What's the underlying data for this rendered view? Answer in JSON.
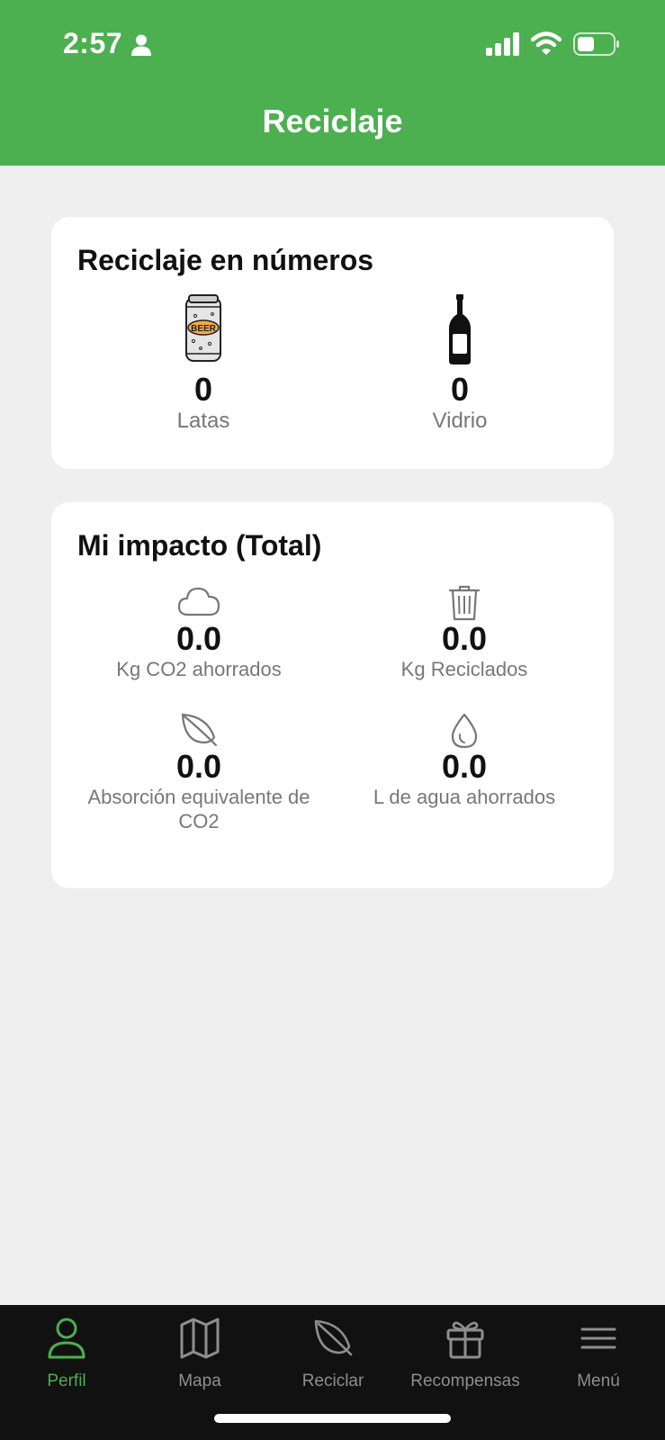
{
  "status_bar": {
    "time": "2:57"
  },
  "header": {
    "title": "Reciclaje"
  },
  "numbers_card": {
    "title": "Reciclaje en números",
    "items": [
      {
        "icon": "beer-can-icon",
        "can_text": "BEER",
        "value": "0",
        "label": "Latas"
      },
      {
        "icon": "wine-bottle-icon",
        "value": "0",
        "label": "Vidrio"
      }
    ]
  },
  "impact_card": {
    "title": "Mi impacto (Total)",
    "items": [
      {
        "icon": "cloud-icon",
        "value": "0.0",
        "label": "Kg CO2 ahorrados"
      },
      {
        "icon": "trash-icon",
        "value": "0.0",
        "label": "Kg Reciclados"
      },
      {
        "icon": "leaf-icon",
        "value": "0.0",
        "label": "Absorción equivalente de CO2"
      },
      {
        "icon": "water-drop-icon",
        "value": "0.0",
        "label": "L de agua ahorrados"
      }
    ]
  },
  "tabbar": {
    "items": [
      {
        "icon": "person-icon",
        "label": "Perfil",
        "active": true
      },
      {
        "icon": "map-icon",
        "label": "Mapa",
        "active": false
      },
      {
        "icon": "leaf-icon",
        "label": "Reciclar",
        "active": false
      },
      {
        "icon": "gift-icon",
        "label": "Recompensas",
        "active": false
      },
      {
        "icon": "hamburger-menu-icon",
        "label": "Menú",
        "active": false
      }
    ]
  },
  "colors": {
    "brand_green": "#4caf50",
    "tabbar_bg": "#111111",
    "page_bg": "#efefef"
  }
}
